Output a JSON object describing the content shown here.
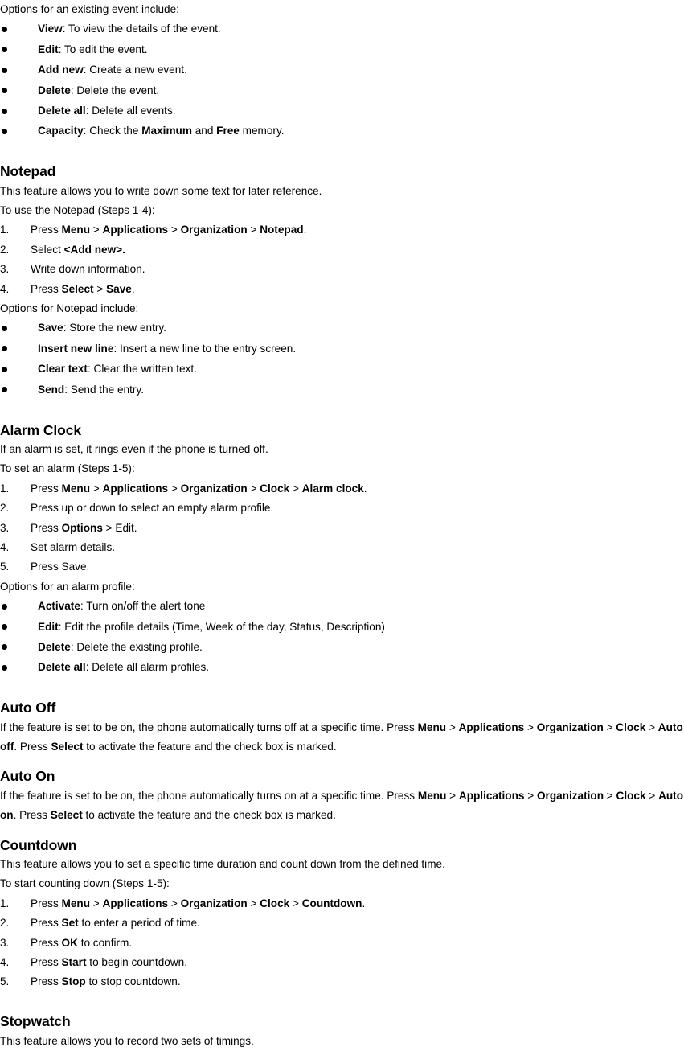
{
  "document": {
    "title": "Phone User Guide - Organization features",
    "blocks": [
      {
        "type": "para",
        "name": "events-options-intro",
        "runs": [
          {
            "t": "Options for an existing event include:",
            "b": false
          }
        ]
      },
      {
        "type": "bullets",
        "name": "event-options-list",
        "items": [
          {
            "runs": [
              {
                "t": "View",
                "b": true
              },
              {
                "t": ": To view the details of the event.",
                "b": false
              }
            ]
          },
          {
            "runs": [
              {
                "t": "Edit",
                "b": true
              },
              {
                "t": ": To edit the event.",
                "b": false
              }
            ]
          },
          {
            "runs": [
              {
                "t": "Add new",
                "b": true
              },
              {
                "t": ": Create a new event.",
                "b": false
              }
            ]
          },
          {
            "runs": [
              {
                "t": "Delete",
                "b": true
              },
              {
                "t": ": Delete the event.",
                "b": false
              }
            ]
          },
          {
            "runs": [
              {
                "t": "Delete all",
                "b": true
              },
              {
                "t": ": Delete all events.",
                "b": false
              }
            ]
          },
          {
            "runs": [
              {
                "t": "Capacity",
                "b": true
              },
              {
                "t": ": Check the ",
                "b": false
              },
              {
                "t": "Maximum",
                "b": true
              },
              {
                "t": " and ",
                "b": false
              },
              {
                "t": "Free",
                "b": true
              },
              {
                "t": " memory.",
                "b": false
              }
            ]
          }
        ]
      },
      {
        "type": "spacer",
        "name": "gap-before-notepad"
      },
      {
        "type": "heading",
        "name": "heading-notepad",
        "runs": [
          {
            "t": "Notepad",
            "b": true
          }
        ]
      },
      {
        "type": "para",
        "name": "notepad-description",
        "runs": [
          {
            "t": "This feature allows you to write down some text for later reference.",
            "b": false
          }
        ]
      },
      {
        "type": "para",
        "name": "notepad-steps-intro",
        "runs": [
          {
            "t": "To use the Notepad (Steps 1-4):",
            "b": false
          }
        ]
      },
      {
        "type": "numbers",
        "name": "notepad-steps-list",
        "items": [
          {
            "num": "1.",
            "runs": [
              {
                "t": "Press ",
                "b": false
              },
              {
                "t": "Menu",
                "b": true
              },
              {
                "t": " > ",
                "b": false
              },
              {
                "t": "Applications",
                "b": true
              },
              {
                "t": " > ",
                "b": false
              },
              {
                "t": "Organization",
                "b": true
              },
              {
                "t": " > ",
                "b": false
              },
              {
                "t": "Notepad",
                "b": true
              },
              {
                "t": ".",
                "b": false
              }
            ]
          },
          {
            "num": "2.",
            "runs": [
              {
                "t": "Select ",
                "b": false
              },
              {
                "t": "<Add new>.",
                "b": true
              }
            ]
          },
          {
            "num": "3.",
            "runs": [
              {
                "t": "Write down information.",
                "b": false
              }
            ]
          },
          {
            "num": "4.",
            "runs": [
              {
                "t": "Press ",
                "b": false
              },
              {
                "t": "Select",
                "b": true
              },
              {
                "t": " > ",
                "b": false
              },
              {
                "t": "Save",
                "b": true
              },
              {
                "t": ".",
                "b": false
              }
            ]
          }
        ]
      },
      {
        "type": "para",
        "name": "notepad-options-intro",
        "runs": [
          {
            "t": "Options for Notepad include:",
            "b": false
          }
        ]
      },
      {
        "type": "bullets",
        "name": "notepad-options-list",
        "items": [
          {
            "runs": [
              {
                "t": "Save",
                "b": true
              },
              {
                "t": ": Store the new entry.",
                "b": false
              }
            ]
          },
          {
            "runs": [
              {
                "t": "Insert new line",
                "b": true
              },
              {
                "t": ": Insert a new line to the entry screen.",
                "b": false
              }
            ]
          },
          {
            "runs": [
              {
                "t": "Clear text",
                "b": true
              },
              {
                "t": ": Clear the written text.",
                "b": false
              }
            ]
          },
          {
            "runs": [
              {
                "t": "Send",
                "b": true
              },
              {
                "t": ": Send the entry.",
                "b": false
              }
            ]
          }
        ]
      },
      {
        "type": "spacer",
        "name": "gap-before-alarm-clock"
      },
      {
        "type": "heading",
        "name": "heading-alarm-clock",
        "runs": [
          {
            "t": "Alarm Clock",
            "b": true
          }
        ]
      },
      {
        "type": "para",
        "name": "alarm-clock-description",
        "runs": [
          {
            "t": "If an alarm is set, it rings even if the phone is turned off.",
            "b": false
          }
        ]
      },
      {
        "type": "para",
        "name": "alarm-steps-intro",
        "runs": [
          {
            "t": "To set an alarm (Steps 1-5):",
            "b": false
          }
        ]
      },
      {
        "type": "numbers",
        "name": "alarm-steps-list",
        "items": [
          {
            "num": "1.",
            "runs": [
              {
                "t": "Press ",
                "b": false
              },
              {
                "t": "Menu",
                "b": true
              },
              {
                "t": " > ",
                "b": false
              },
              {
                "t": "Applications",
                "b": true
              },
              {
                "t": " > ",
                "b": false
              },
              {
                "t": "Organization",
                "b": true
              },
              {
                "t": " > ",
                "b": false
              },
              {
                "t": "Clock",
                "b": true
              },
              {
                "t": " > ",
                "b": false
              },
              {
                "t": "Alarm clock",
                "b": true
              },
              {
                "t": ".",
                "b": false
              }
            ]
          },
          {
            "num": "2.",
            "runs": [
              {
                "t": "Press up or down to select an empty alarm profile.",
                "b": false
              }
            ]
          },
          {
            "num": "3.",
            "runs": [
              {
                "t": "Press ",
                "b": false
              },
              {
                "t": "Options",
                "b": true
              },
              {
                "t": " > Edit.",
                "b": false
              }
            ]
          },
          {
            "num": "4.",
            "runs": [
              {
                "t": "Set alarm details.",
                "b": false
              }
            ]
          },
          {
            "num": "5.",
            "runs": [
              {
                "t": "Press Save.",
                "b": false
              }
            ]
          }
        ]
      },
      {
        "type": "para",
        "name": "alarm-profile-options-intro",
        "runs": [
          {
            "t": "Options for an alarm profile:",
            "b": false
          }
        ]
      },
      {
        "type": "bullets",
        "name": "alarm-profile-options-list",
        "items": [
          {
            "runs": [
              {
                "t": "Activate",
                "b": true
              },
              {
                "t": ": Turn on/off the alert tone",
                "b": false
              }
            ]
          },
          {
            "runs": [
              {
                "t": "Edit",
                "b": true
              },
              {
                "t": ": Edit the profile details (Time, Week of the day, Status, Description)",
                "b": false
              }
            ]
          },
          {
            "runs": [
              {
                "t": "Delete",
                "b": true
              },
              {
                "t": ": Delete the existing profile.",
                "b": false
              }
            ]
          },
          {
            "runs": [
              {
                "t": "Delete all",
                "b": true
              },
              {
                "t": ": Delete all alarm profiles.",
                "b": false
              }
            ]
          }
        ]
      },
      {
        "type": "spacer",
        "name": "gap-before-auto-off"
      },
      {
        "type": "heading",
        "name": "heading-auto-off",
        "runs": [
          {
            "t": "Auto Off",
            "b": true
          }
        ]
      },
      {
        "type": "para",
        "name": "auto-off-description",
        "runs": [
          {
            "t": "If the feature is set to be on, the phone automatically turns off at a specific time. Press ",
            "b": false
          },
          {
            "t": "Menu",
            "b": true
          },
          {
            "t": " > ",
            "b": false
          },
          {
            "t": "Applications",
            "b": true
          },
          {
            "t": " > ",
            "b": false
          },
          {
            "t": "Organization",
            "b": true
          },
          {
            "t": " > ",
            "b": false
          },
          {
            "t": "Clock",
            "b": true
          },
          {
            "t": " > ",
            "b": false
          },
          {
            "t": "Auto off",
            "b": true
          },
          {
            "t": ". Press ",
            "b": false
          },
          {
            "t": "Select",
            "b": true
          },
          {
            "t": " to activate the feature and the check box is marked.",
            "b": false
          }
        ]
      },
      {
        "type": "spacer-sm",
        "name": "gap-before-auto-on"
      },
      {
        "type": "heading",
        "name": "heading-auto-on",
        "runs": [
          {
            "t": "Auto On",
            "b": true
          }
        ]
      },
      {
        "type": "para",
        "name": "auto-on-description",
        "runs": [
          {
            "t": "If the feature is set to be on, the phone automatically turns on at a specific time. Press ",
            "b": false
          },
          {
            "t": "Menu",
            "b": true
          },
          {
            "t": " > ",
            "b": false
          },
          {
            "t": "Applications",
            "b": true
          },
          {
            "t": " > ",
            "b": false
          },
          {
            "t": "Organization",
            "b": true
          },
          {
            "t": " > ",
            "b": false
          },
          {
            "t": "Clock",
            "b": true
          },
          {
            "t": " > ",
            "b": false
          },
          {
            "t": "Auto on",
            "b": true
          },
          {
            "t": ". Press ",
            "b": false
          },
          {
            "t": "Select",
            "b": true
          },
          {
            "t": " to activate the feature and the check box is marked.",
            "b": false
          }
        ]
      },
      {
        "type": "spacer-sm",
        "name": "gap-before-countdown"
      },
      {
        "type": "heading",
        "name": "heading-countdown",
        "runs": [
          {
            "t": "Countdown",
            "b": true
          }
        ]
      },
      {
        "type": "para",
        "name": "countdown-description",
        "runs": [
          {
            "t": "This feature allows you to set a specific time duration and count down from the defined time.",
            "b": false
          }
        ]
      },
      {
        "type": "para",
        "name": "countdown-steps-intro",
        "runs": [
          {
            "t": "To start counting down (Steps 1-5):",
            "b": false
          }
        ]
      },
      {
        "type": "numbers",
        "name": "countdown-steps-list",
        "items": [
          {
            "num": "1.",
            "runs": [
              {
                "t": "Press ",
                "b": false
              },
              {
                "t": "Menu",
                "b": true
              },
              {
                "t": " > ",
                "b": false
              },
              {
                "t": "Applications",
                "b": true
              },
              {
                "t": " > ",
                "b": false
              },
              {
                "t": "Organization",
                "b": true
              },
              {
                "t": " > ",
                "b": false
              },
              {
                "t": "Clock",
                "b": true
              },
              {
                "t": " > ",
                "b": false
              },
              {
                "t": "Countdown",
                "b": true
              },
              {
                "t": ".",
                "b": false
              }
            ]
          },
          {
            "num": "2.",
            "runs": [
              {
                "t": "Press ",
                "b": false
              },
              {
                "t": "Set",
                "b": true
              },
              {
                "t": " to enter a period of time.",
                "b": false
              }
            ]
          },
          {
            "num": "3.",
            "runs": [
              {
                "t": "Press ",
                "b": false
              },
              {
                "t": "OK",
                "b": true
              },
              {
                "t": " to confirm.",
                "b": false
              }
            ]
          },
          {
            "num": "4.",
            "runs": [
              {
                "t": "Press ",
                "b": false
              },
              {
                "t": "Start",
                "b": true
              },
              {
                "t": " to begin countdown.",
                "b": false
              }
            ]
          },
          {
            "num": "5.",
            "runs": [
              {
                "t": "Press ",
                "b": false
              },
              {
                "t": "Stop",
                "b": true
              },
              {
                "t": " to stop countdown.",
                "b": false
              }
            ]
          }
        ]
      },
      {
        "type": "spacer",
        "name": "gap-before-stopwatch"
      },
      {
        "type": "heading",
        "name": "heading-stopwatch",
        "runs": [
          {
            "t": "Stopwatch",
            "b": true
          }
        ]
      },
      {
        "type": "para",
        "name": "stopwatch-description",
        "runs": [
          {
            "t": "This feature allows you to record two sets of timings.",
            "b": false
          }
        ]
      }
    ]
  }
}
